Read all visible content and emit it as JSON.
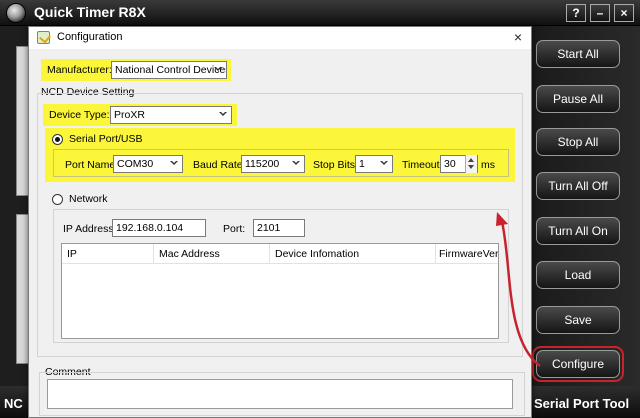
{
  "app": {
    "title": "Quick Timer R8X",
    "help_label": "?",
    "minimize_label": "–",
    "close_label": "×",
    "bottom_left": "NC",
    "bottom_right": "Serial Port Tool"
  },
  "side_buttons": [
    {
      "label": "Start All"
    },
    {
      "label": "Pause All"
    },
    {
      "label": "Stop All"
    },
    {
      "label": "Turn All Off"
    },
    {
      "label": "Turn All On"
    },
    {
      "label": "Load"
    },
    {
      "label": "Save"
    },
    {
      "label": "Configure"
    }
  ],
  "dialog": {
    "title": "Configuration",
    "close_label": "×",
    "manufacturer_label": "Manufacturer:",
    "manufacturer_value": "National Control Devices",
    "ncd_group_label": "NCD Device Setting",
    "device_type_label": "Device Type:",
    "device_type_value": "ProXR",
    "serial_label": "Serial Port/USB",
    "port_name_label": "Port Name:",
    "port_name_value": "COM30",
    "baud_rate_label": "Baud Rate:",
    "baud_rate_value": "115200",
    "stop_bits_label": "Stop Bits:",
    "stop_bits_value": "1",
    "timeout_label": "Timeout:",
    "timeout_value": "30",
    "timeout_unit": "ms",
    "network_label": "Network",
    "ip_label": "IP Address:",
    "ip_value": "192.168.0.104",
    "port_label": "Port:",
    "port_value": "2101",
    "columns": [
      "IP",
      "Mac Address",
      "Device Infomation",
      "FirmwareVersion"
    ],
    "comment_label": "Comment"
  },
  "colors": {
    "highlight": "#fbf63a",
    "annotation_red": "#c8232c"
  }
}
